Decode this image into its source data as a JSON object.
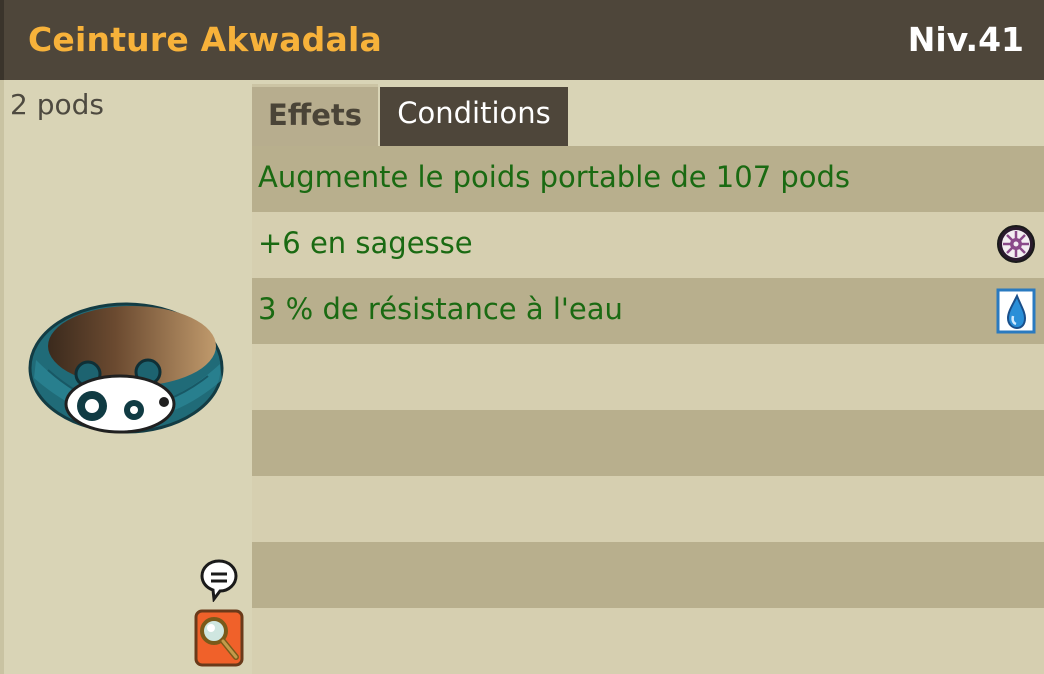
{
  "item": {
    "name": "Ceinture Akwadala",
    "level": "Niv.41",
    "weight": "2 pods"
  },
  "tabs": {
    "effects": "Effets",
    "conditions": "Conditions",
    "active": "effects"
  },
  "effects": [
    {
      "text": "Augmente le poids portable de 107 pods",
      "icon": null
    },
    {
      "text": "+6 en sagesse",
      "icon": "wisdom-icon"
    },
    {
      "text": "3 % de résistance à l'eau",
      "icon": "water-icon"
    },
    {
      "text": "",
      "icon": null
    },
    {
      "text": "",
      "icon": null
    },
    {
      "text": "",
      "icon": null
    },
    {
      "text": "",
      "icon": null
    },
    {
      "text": "",
      "icon": null
    }
  ],
  "colors": {
    "title": "#f7b23a",
    "header_bg": "#4e463a",
    "effect_text": "#1a6a12",
    "panel_bg": "#d9d4b6"
  }
}
